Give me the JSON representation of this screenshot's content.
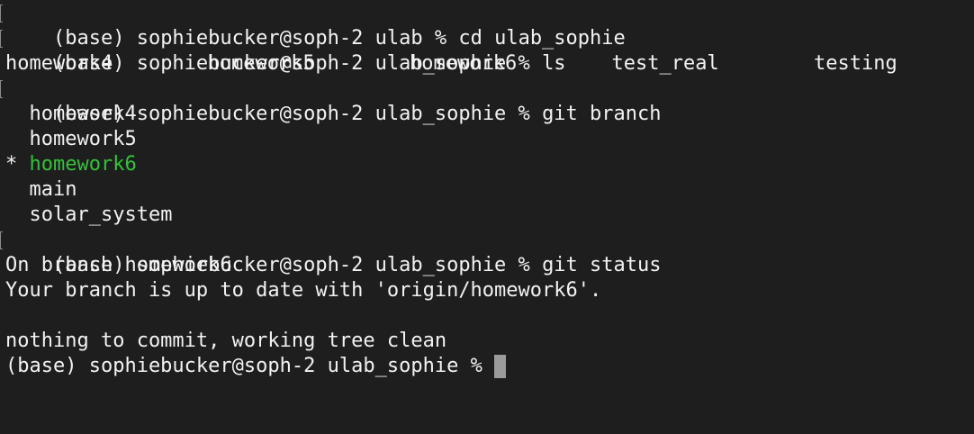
{
  "terminal": {
    "prompt": "(base) sophiebucker@soph-2",
    "lines": [
      {
        "dir": "ulab",
        "cmd": "cd ulab_sophie"
      },
      {
        "dir": "ulab_sophie",
        "cmd": "ls"
      },
      {
        "dir": "ulab_sophie",
        "cmd": "git branch"
      },
      {
        "dir": "ulab_sophie",
        "cmd": "git status"
      },
      {
        "dir": "ulab_sophie",
        "cmd": ""
      }
    ],
    "ls_output": [
      "homework4",
      "homework5",
      "homework6",
      "test_real",
      "testing"
    ],
    "branches": [
      {
        "name": "homework4",
        "prefix": "  "
      },
      {
        "name": "homework5",
        "prefix": "  "
      },
      {
        "name": "homework6",
        "prefix": "* "
      },
      {
        "name": "main",
        "prefix": "  "
      },
      {
        "name": "solar_system",
        "prefix": "  "
      }
    ],
    "status": {
      "line1": "On branch homework6",
      "line2": "Your branch is up to date with 'origin/homework6'.",
      "line3": "nothing to commit, working tree clean"
    },
    "colors": {
      "background": "#1e1e1e",
      "text": "#f2f2f2",
      "current_branch": "#33c23a",
      "cursor": "#9b9b9b"
    }
  }
}
